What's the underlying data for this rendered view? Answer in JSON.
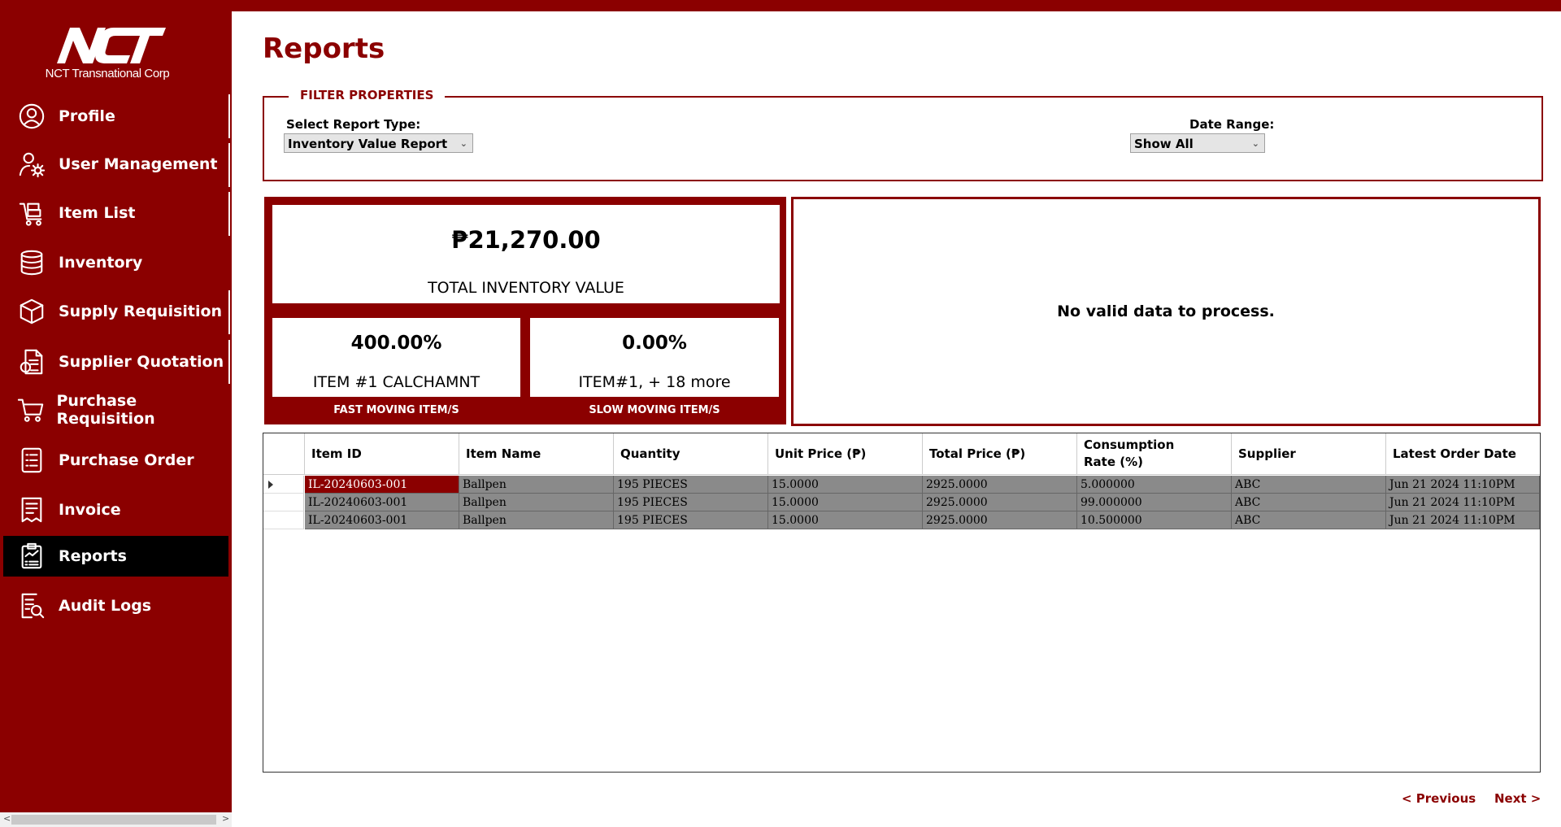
{
  "company": {
    "logo_letters": "NCT",
    "name": "NCT Transnational Corp"
  },
  "sidebar": {
    "items": [
      {
        "label": "Profile",
        "icon": "user-circle-icon"
      },
      {
        "label": "User Management",
        "icon": "user-gear-icon"
      },
      {
        "label": "Item List",
        "icon": "cart-list-icon"
      },
      {
        "label": "Inventory",
        "icon": "database-icon"
      },
      {
        "label": "Supply Requisition",
        "icon": "box-icon"
      },
      {
        "label": "Supplier Quotation",
        "icon": "quotation-icon"
      },
      {
        "label": "Purchase Requisition",
        "icon": "shopping-cart-icon"
      },
      {
        "label": "Purchase Order",
        "icon": "order-list-icon"
      },
      {
        "label": "Invoice",
        "icon": "invoice-icon"
      },
      {
        "label": "Reports",
        "icon": "reports-icon",
        "active": true
      },
      {
        "label": "Audit Logs",
        "icon": "audit-search-icon"
      }
    ]
  },
  "page": {
    "title": "Reports"
  },
  "filter": {
    "legend": "FILTER PROPERTIES",
    "report_type_label": "Select Report Type:",
    "report_type_value": "Inventory Value Report",
    "date_range_label": "Date Range:",
    "date_range_value": "Show All"
  },
  "summary": {
    "total_value": "₱21,270.00",
    "total_label": "TOTAL INVENTORY VALUE",
    "fast": {
      "value": "400.00%",
      "item": "ITEM #1 CALCHAMNT",
      "caption": "FAST MOVING ITEM/S"
    },
    "slow": {
      "value": "0.00%",
      "item": "ITEM#1, + 18 more",
      "caption": "SLOW MOVING ITEM/S"
    }
  },
  "chart": {
    "message": "No valid data to process."
  },
  "table": {
    "columns": [
      "Item ID",
      "Item Name",
      "Quantity",
      "Unit Price (₱)",
      "Total Price (₱)",
      "Consumption Rate (%)",
      "Supplier",
      "Latest Order Date"
    ],
    "rows": [
      [
        "IL-20240603-001",
        "Ballpen",
        "195 PIECES",
        "15.0000",
        "2925.0000",
        "5.000000",
        "ABC",
        "Jun 21 2024 11:10PM"
      ],
      [
        "IL-20240603-001",
        "Ballpen",
        "195 PIECES",
        "15.0000",
        "2925.0000",
        "99.000000",
        "ABC",
        "Jun 21 2024 11:10PM"
      ],
      [
        "IL-20240603-001",
        "Ballpen",
        "195 PIECES",
        "15.0000",
        "2925.0000",
        "10.500000",
        "ABC",
        "Jun 21 2024 11:10PM"
      ]
    ]
  },
  "pager": {
    "previous": "< Previous",
    "next": "Next >"
  },
  "colors": {
    "brand": "#8b0000",
    "active_nav": "#000000",
    "row_bg": "#8a8a8a"
  }
}
